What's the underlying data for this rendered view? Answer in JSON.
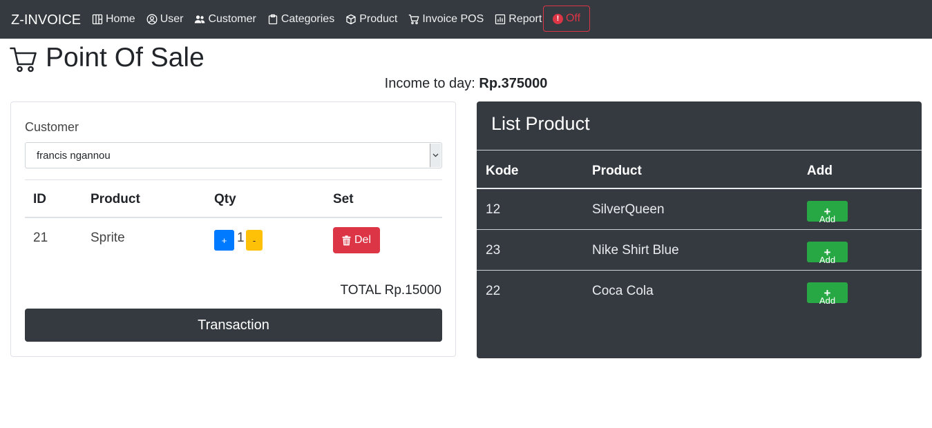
{
  "navbar": {
    "brand": "Z-INVOICE",
    "items": [
      {
        "label": "Home",
        "icon": "columns-icon"
      },
      {
        "label": "User",
        "icon": "user-circle-icon"
      },
      {
        "label": "Customer",
        "icon": "users-icon"
      },
      {
        "label": "Categories",
        "icon": "clipboard-icon"
      },
      {
        "label": "Product",
        "icon": "box-icon"
      },
      {
        "label": "Invoice POS",
        "icon": "cart-icon"
      },
      {
        "label": "Report",
        "icon": "bar-chart-icon"
      }
    ],
    "off_label": "Off",
    "off_icon_glyph": "!"
  },
  "page": {
    "title": "Point Of Sale",
    "income_label": "Income to day:",
    "income_value": "Rp.375000"
  },
  "cart": {
    "customer_label": "Customer",
    "customer_selected": "francis ngannou",
    "columns": [
      "ID",
      "Product",
      "Qty",
      "Set"
    ],
    "rows": [
      {
        "id": "21",
        "product": "Sprite",
        "qty": "1",
        "plus": "+",
        "minus": "-",
        "del": "Del"
      }
    ],
    "total": "TOTAL Rp.15000",
    "transaction_label": "Transaction"
  },
  "products": {
    "title": "List Product",
    "columns": [
      "Kode",
      "Product",
      "Add"
    ],
    "rows": [
      {
        "kode": "12",
        "product": "SilverQueen",
        "add": "Add"
      },
      {
        "kode": "23",
        "product": "Nike Shirt Blue",
        "add": "Add"
      },
      {
        "kode": "22",
        "product": "Coca Cola",
        "add": "Add"
      }
    ],
    "add_glyph": "+"
  },
  "colors": {
    "navbar_bg": "#343a40",
    "primary": "#007bff",
    "warning": "#ffc107",
    "danger": "#dc3545",
    "success": "#28a745"
  }
}
